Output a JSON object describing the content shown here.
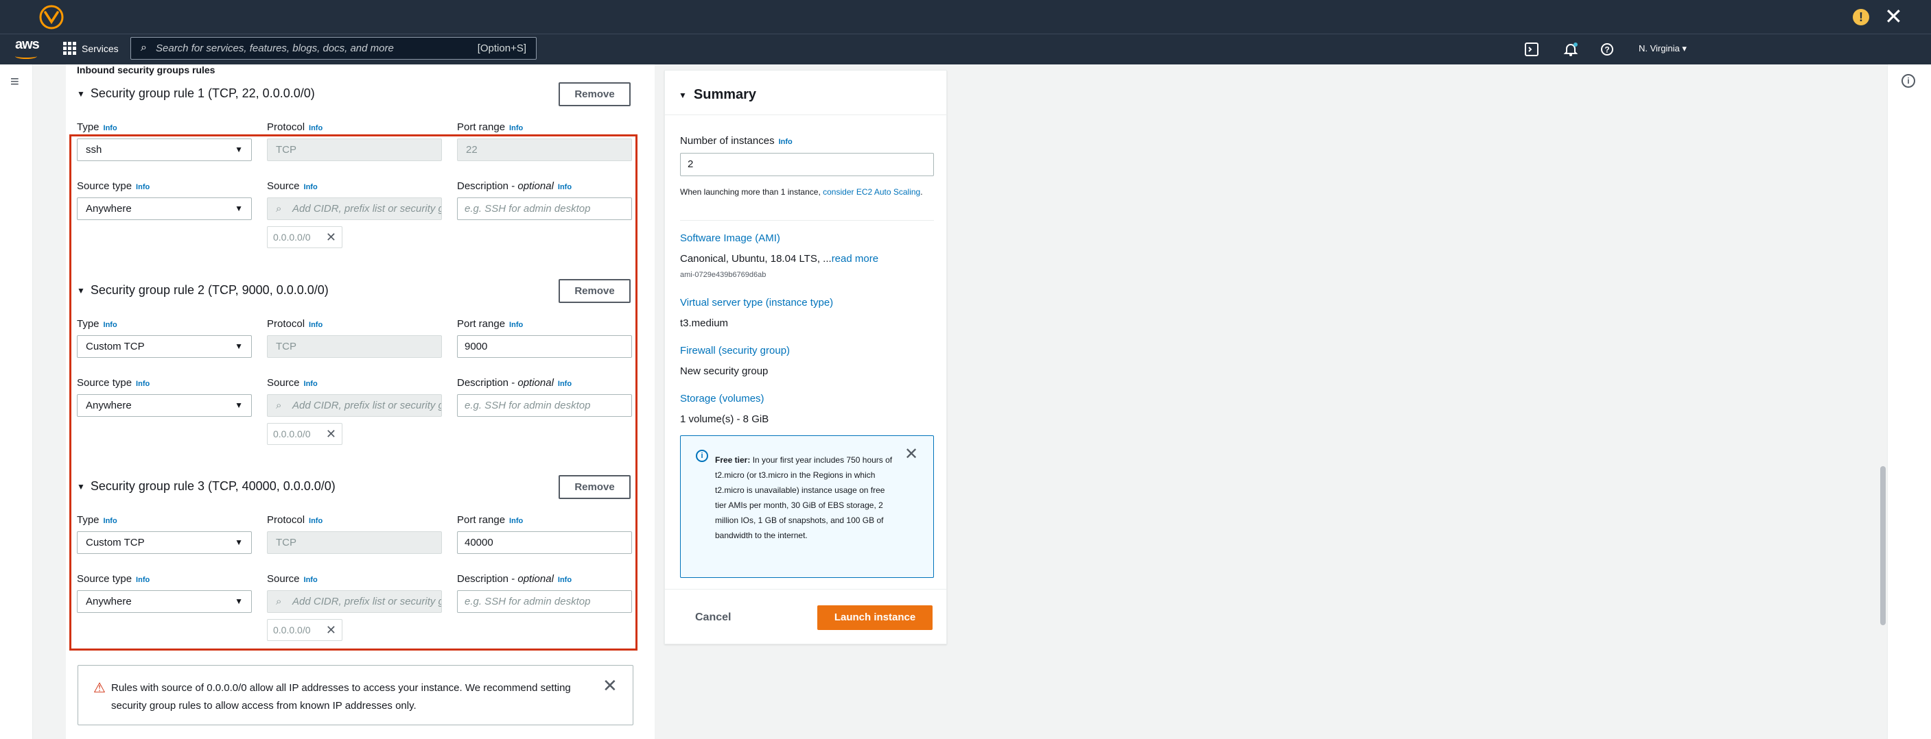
{
  "window": {
    "close_glyph": "✕",
    "warn_glyph": "!"
  },
  "nav": {
    "logo": "aws",
    "services": "Services",
    "search_placeholder": "Search for services, features, blogs, docs, and more",
    "search_shortcut": "[Option+S]",
    "region": "N. Virginia ▾",
    "icons": [
      "cloudshell-icon",
      "bell-icon",
      "help-icon"
    ]
  },
  "section_title": "Inbound security groups rules",
  "labels": {
    "type": "Type",
    "protocol": "Protocol",
    "port_range": "Port range",
    "source_type": "Source type",
    "source": "Source",
    "description": "Description - ",
    "optional": "optional",
    "info": "Info",
    "remove": "Remove",
    "source_placeholder": "Add CIDR, prefix list or security group",
    "description_placeholder": "e.g. SSH for admin desktop"
  },
  "rules": [
    {
      "title": "Security group rule 1 (TCP, 22, 0.0.0.0/0)",
      "type": "ssh",
      "protocol": "TCP",
      "port": "22",
      "source_type": "Anywhere",
      "cidr": "0.0.0.0/0"
    },
    {
      "title": "Security group rule 2 (TCP, 9000, 0.0.0.0/0)",
      "type": "Custom TCP",
      "protocol": "TCP",
      "port": "9000",
      "source_type": "Anywhere",
      "cidr": "0.0.0.0/0"
    },
    {
      "title": "Security group rule 3 (TCP, 40000, 0.0.0.0/0)",
      "type": "Custom TCP",
      "protocol": "TCP",
      "port": "40000",
      "source_type": "Anywhere",
      "cidr": "0.0.0.0/0"
    }
  ],
  "alert": {
    "text": "Rules with source of 0.0.0.0/0 allow all IP addresses to access your instance. We recommend setting security group rules to allow access from known IP addresses only."
  },
  "summary": {
    "title": "Summary",
    "instances_label": "Number of instances",
    "instances_value": "2",
    "note_prefix": "When launching more than 1 instance, ",
    "note_link": "consider EC2 Auto Scaling",
    "note_suffix": ".",
    "ami_label": "Software Image (AMI)",
    "ami_value": "Canonical, Ubuntu, 18.04 LTS, ...",
    "ami_read_more": "read more",
    "ami_id": "ami-0729e439b6769d6ab",
    "instance_type_label": "Virtual server type (instance type)",
    "instance_type_value": "t3.medium",
    "firewall_label": "Firewall (security group)",
    "firewall_value": "New security group",
    "storage_label": "Storage (volumes)",
    "storage_value": "1 volume(s) - 8 GiB",
    "free_tier_bold": "Free tier:",
    "free_tier_text": " In your first year includes 750 hours of t2.micro (or t3.micro in the Regions in which t2.micro is unavailable) instance usage on free tier AMIs per month, 30 GiB of EBS storage, 2 million IOs, 1 GB of snapshots, and 100 GB of bandwidth to the internet.",
    "cancel": "Cancel",
    "launch": "Launch instance"
  },
  "colors": {
    "accent": "#ec7211",
    "link": "#0073bb",
    "highlight_box": "#d13212",
    "topbar": "#232f3e"
  }
}
